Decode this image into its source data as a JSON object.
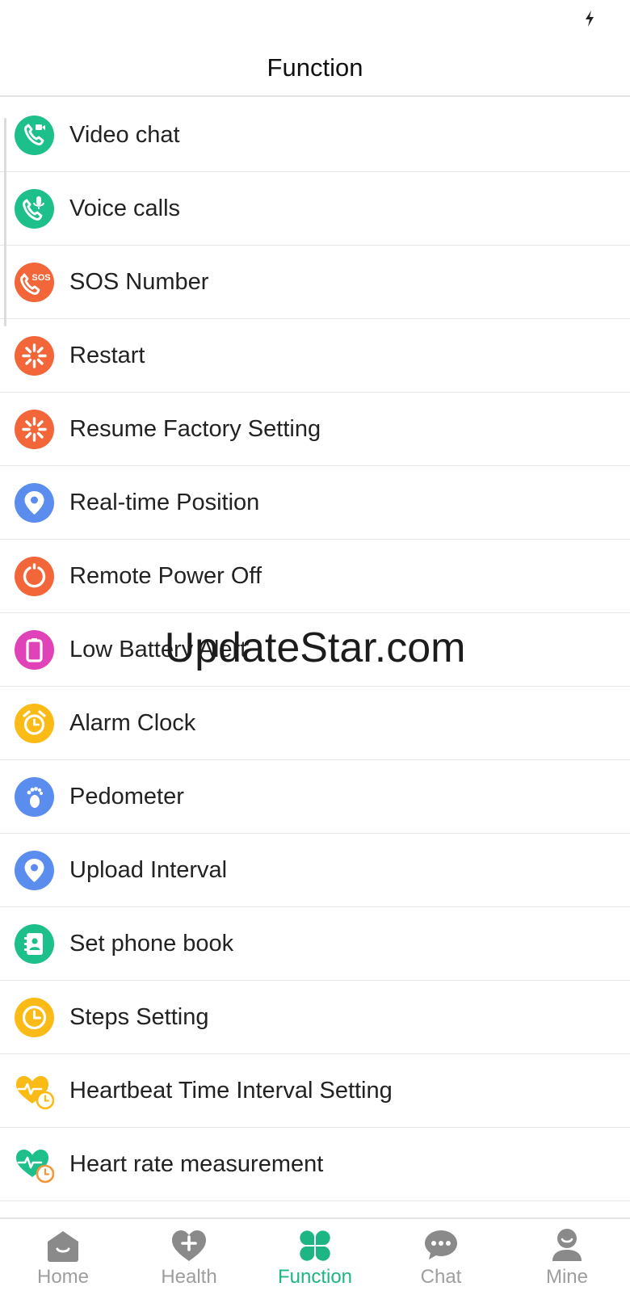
{
  "header": {
    "title": "Function"
  },
  "colors": {
    "green": "#1dbf8a",
    "orange": "#f2663a",
    "blue": "#5b8def",
    "magenta": "#e043b8",
    "yellow": "#fbbb16",
    "tab_active": "#1db584",
    "tab_inactive": "#9e9e9e"
  },
  "functions": [
    {
      "label": "Video chat",
      "icon": "video-call-icon"
    },
    {
      "label": "Voice calls",
      "icon": "voice-call-icon"
    },
    {
      "label": "SOS Number",
      "icon": "sos-phone-icon",
      "icon_text": "SOS"
    },
    {
      "label": "Restart",
      "icon": "restart-icon"
    },
    {
      "label": "Resume Factory Setting",
      "icon": "factory-reset-icon"
    },
    {
      "label": "Real-time Position",
      "icon": "location-pin-icon"
    },
    {
      "label": "Remote Power Off",
      "icon": "power-icon"
    },
    {
      "label": "Low Battery Alert",
      "icon": "battery-icon"
    },
    {
      "label": "Alarm Clock",
      "icon": "alarm-clock-icon"
    },
    {
      "label": "Pedometer",
      "icon": "footprint-icon"
    },
    {
      "label": "Upload Interval",
      "icon": "location-pin-icon"
    },
    {
      "label": "Set phone book",
      "icon": "contact-book-icon"
    },
    {
      "label": "Steps Setting",
      "icon": "clock-icon"
    },
    {
      "label": "Heartbeat Time Interval Setting",
      "icon": "heartbeat-timer-icon"
    },
    {
      "label": "Heart rate measurement",
      "icon": "heart-rate-icon"
    }
  ],
  "watermark": "UpdateStar.com",
  "tabs": [
    {
      "label": "Home",
      "icon": "home-icon",
      "active": false
    },
    {
      "label": "Health",
      "icon": "heart-plus-icon",
      "active": false
    },
    {
      "label": "Function",
      "icon": "clover-icon",
      "active": true
    },
    {
      "label": "Chat",
      "icon": "chat-bubble-icon",
      "active": false
    },
    {
      "label": "Mine",
      "icon": "user-icon",
      "active": false
    }
  ]
}
